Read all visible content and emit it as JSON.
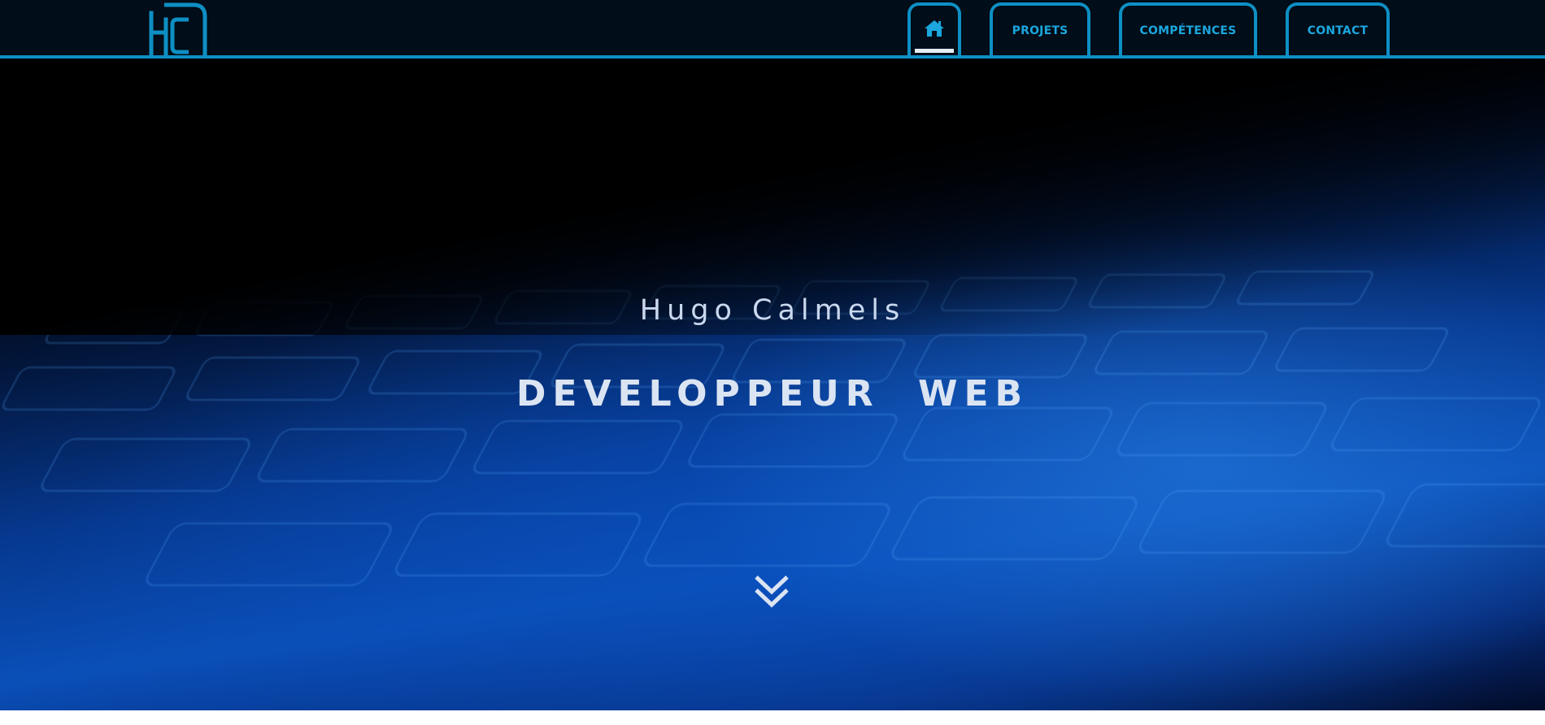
{
  "header": {
    "logo_text": "HC",
    "nav": {
      "home_icon": "home-icon",
      "projets_label": "PROJETS",
      "competences_label": "COMPÉTENCES",
      "contact_label": "CONTACT"
    }
  },
  "hero": {
    "name": "Hugo Calmels",
    "title": "DEVELOPPEUR WEB",
    "scroll_icon": "double-chevron-down-icon"
  },
  "colors": {
    "accent": "#0e8fc4",
    "nav_background": "#010d18",
    "nav_text": "#1ba6de",
    "hero_text": "#dbe4f2"
  }
}
